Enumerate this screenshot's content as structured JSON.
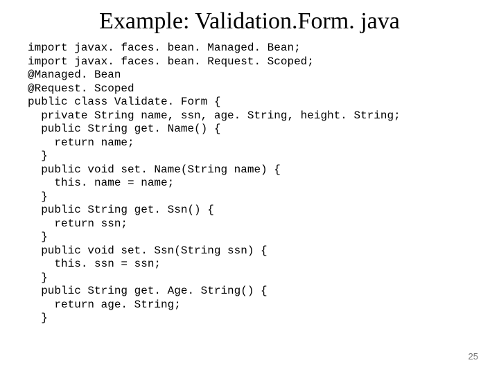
{
  "title": "Example: Validation.Form. java",
  "code_lines": [
    "import javax. faces. bean. Managed. Bean;",
    "import javax. faces. bean. Request. Scoped;",
    "@Managed. Bean",
    "@Request. Scoped",
    "public class Validate. Form {",
    "  private String name, ssn, age. String, height. String;",
    "  public String get. Name() {",
    "    return name;",
    "  }",
    "  public void set. Name(String name) {",
    "    this. name = name;",
    "  }",
    "  public String get. Ssn() {",
    "    return ssn;",
    "  }",
    "  public void set. Ssn(String ssn) {",
    "    this. ssn = ssn;",
    "  }",
    "  public String get. Age. String() {",
    "    return age. String;",
    "  }"
  ],
  "page_number": "25"
}
